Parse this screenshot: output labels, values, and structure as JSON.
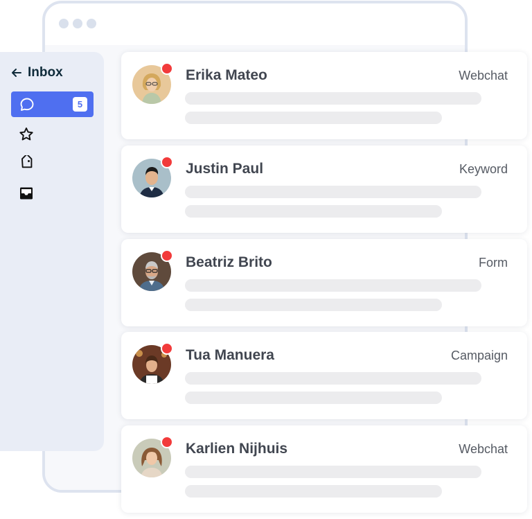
{
  "sidebar": {
    "title": "Inbox",
    "back_icon": "arrow-left-icon",
    "items": [
      {
        "icon": "chat-bubble-icon",
        "badge": "5",
        "active": true
      },
      {
        "icon": "star-icon"
      },
      {
        "icon": "tag-icon"
      },
      {
        "icon": "inbox-tray-icon"
      }
    ]
  },
  "conversations": [
    {
      "name": "Erika Mateo",
      "source": "Webchat",
      "unread": true
    },
    {
      "name": "Justin Paul",
      "source": "Keyword",
      "unread": true
    },
    {
      "name": "Beatriz Brito",
      "source": "Form",
      "unread": true
    },
    {
      "name": "Tua Manuera",
      "source": "Campaign",
      "unread": true
    },
    {
      "name": "Karlien Nijhuis",
      "source": "Webchat",
      "unread": true
    }
  ],
  "colors": {
    "accent": "#4f6ff0",
    "unread_dot": "#f23b3b",
    "sidebar_bg": "#e9edf6",
    "skeleton": "#ececee"
  }
}
